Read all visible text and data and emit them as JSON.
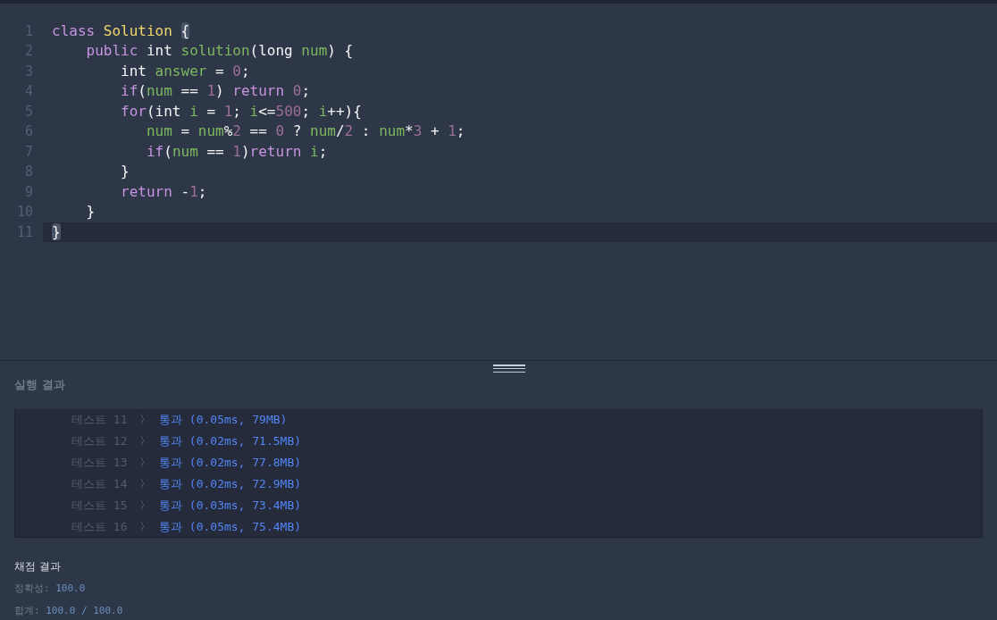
{
  "editor": {
    "lines": [
      {
        "number": "1",
        "current": false,
        "tokens": [
          {
            "text": "class ",
            "kind": "keyword"
          },
          {
            "text": "Solution ",
            "kind": "class"
          },
          {
            "text": "{",
            "kind": "match"
          }
        ]
      },
      {
        "number": "2",
        "current": false,
        "tokens": [
          {
            "text": "    public ",
            "kind": "keyword"
          },
          {
            "text": "int ",
            "kind": "plain"
          },
          {
            "text": "solution",
            "kind": "ident"
          },
          {
            "text": "(long ",
            "kind": "plain"
          },
          {
            "text": "num",
            "kind": "ident"
          },
          {
            "text": ") {",
            "kind": "plain"
          }
        ]
      },
      {
        "number": "3",
        "current": false,
        "tokens": [
          {
            "text": "        int ",
            "kind": "plain"
          },
          {
            "text": "answer",
            "kind": "ident"
          },
          {
            "text": " = ",
            "kind": "plain"
          },
          {
            "text": "0",
            "kind": "number"
          },
          {
            "text": ";",
            "kind": "plain"
          }
        ]
      },
      {
        "number": "4",
        "current": false,
        "tokens": [
          {
            "text": "        if",
            "kind": "keyword"
          },
          {
            "text": "(",
            "kind": "plain"
          },
          {
            "text": "num",
            "kind": "ident"
          },
          {
            "text": " == ",
            "kind": "plain"
          },
          {
            "text": "1",
            "kind": "number"
          },
          {
            "text": ") ",
            "kind": "plain"
          },
          {
            "text": "return ",
            "kind": "keyword"
          },
          {
            "text": "0",
            "kind": "number"
          },
          {
            "text": ";",
            "kind": "plain"
          }
        ]
      },
      {
        "number": "5",
        "current": false,
        "tokens": [
          {
            "text": "        for",
            "kind": "keyword"
          },
          {
            "text": "(int ",
            "kind": "plain"
          },
          {
            "text": "i",
            "kind": "ident"
          },
          {
            "text": " = ",
            "kind": "plain"
          },
          {
            "text": "1",
            "kind": "number"
          },
          {
            "text": "; ",
            "kind": "plain"
          },
          {
            "text": "i",
            "kind": "ident"
          },
          {
            "text": "<=",
            "kind": "plain"
          },
          {
            "text": "500",
            "kind": "number"
          },
          {
            "text": "; ",
            "kind": "plain"
          },
          {
            "text": "i",
            "kind": "ident"
          },
          {
            "text": "++){",
            "kind": "plain"
          }
        ]
      },
      {
        "number": "6",
        "current": false,
        "tokens": [
          {
            "text": "           num",
            "kind": "ident"
          },
          {
            "text": " = ",
            "kind": "plain"
          },
          {
            "text": "num",
            "kind": "ident"
          },
          {
            "text": "%",
            "kind": "plain"
          },
          {
            "text": "2",
            "kind": "number"
          },
          {
            "text": " == ",
            "kind": "plain"
          },
          {
            "text": "0",
            "kind": "number"
          },
          {
            "text": " ? ",
            "kind": "plain"
          },
          {
            "text": "num",
            "kind": "ident"
          },
          {
            "text": "/",
            "kind": "plain"
          },
          {
            "text": "2",
            "kind": "number"
          },
          {
            "text": " : ",
            "kind": "plain"
          },
          {
            "text": "num",
            "kind": "ident"
          },
          {
            "text": "*",
            "kind": "plain"
          },
          {
            "text": "3",
            "kind": "number"
          },
          {
            "text": " + ",
            "kind": "plain"
          },
          {
            "text": "1",
            "kind": "number"
          },
          {
            "text": ";",
            "kind": "plain"
          }
        ]
      },
      {
        "number": "7",
        "current": false,
        "tokens": [
          {
            "text": "           if",
            "kind": "keyword"
          },
          {
            "text": "(",
            "kind": "plain"
          },
          {
            "text": "num",
            "kind": "ident"
          },
          {
            "text": " == ",
            "kind": "plain"
          },
          {
            "text": "1",
            "kind": "number"
          },
          {
            "text": ")",
            "kind": "plain"
          },
          {
            "text": "return ",
            "kind": "keyword"
          },
          {
            "text": "i",
            "kind": "ident"
          },
          {
            "text": ";",
            "kind": "plain"
          }
        ]
      },
      {
        "number": "8",
        "current": false,
        "tokens": [
          {
            "text": "        }",
            "kind": "plain"
          }
        ]
      },
      {
        "number": "9",
        "current": false,
        "tokens": [
          {
            "text": "        return ",
            "kind": "keyword"
          },
          {
            "text": "-",
            "kind": "plain"
          },
          {
            "text": "1",
            "kind": "number"
          },
          {
            "text": ";",
            "kind": "plain"
          }
        ]
      },
      {
        "number": "10",
        "current": false,
        "tokens": [
          {
            "text": "    }",
            "kind": "plain"
          }
        ]
      },
      {
        "number": "11",
        "current": true,
        "tokens": [
          {
            "text": "}",
            "kind": "match"
          }
        ]
      }
    ]
  },
  "results": {
    "title": "실행 결과",
    "rows": [
      {
        "label": "테스트 11",
        "separator": "〉",
        "result": "통과 (0.05ms, 79MB)"
      },
      {
        "label": "테스트 12",
        "separator": "〉",
        "result": "통과 (0.02ms, 71.5MB)"
      },
      {
        "label": "테스트 13",
        "separator": "〉",
        "result": "통과 (0.02ms, 77.8MB)"
      },
      {
        "label": "테스트 14",
        "separator": "〉",
        "result": "통과 (0.02ms, 72.9MB)"
      },
      {
        "label": "테스트 15",
        "separator": "〉",
        "result": "통과 (0.03ms, 73.4MB)"
      },
      {
        "label": "테스트 16",
        "separator": "〉",
        "result": "통과 (0.05ms, 75.4MB)"
      }
    ]
  },
  "grading": {
    "title": "채점 결과",
    "items": [
      {
        "label": "정확성: ",
        "value": "100.0"
      },
      {
        "label": "합계: ",
        "value": "100.0 / 100.0"
      }
    ]
  }
}
